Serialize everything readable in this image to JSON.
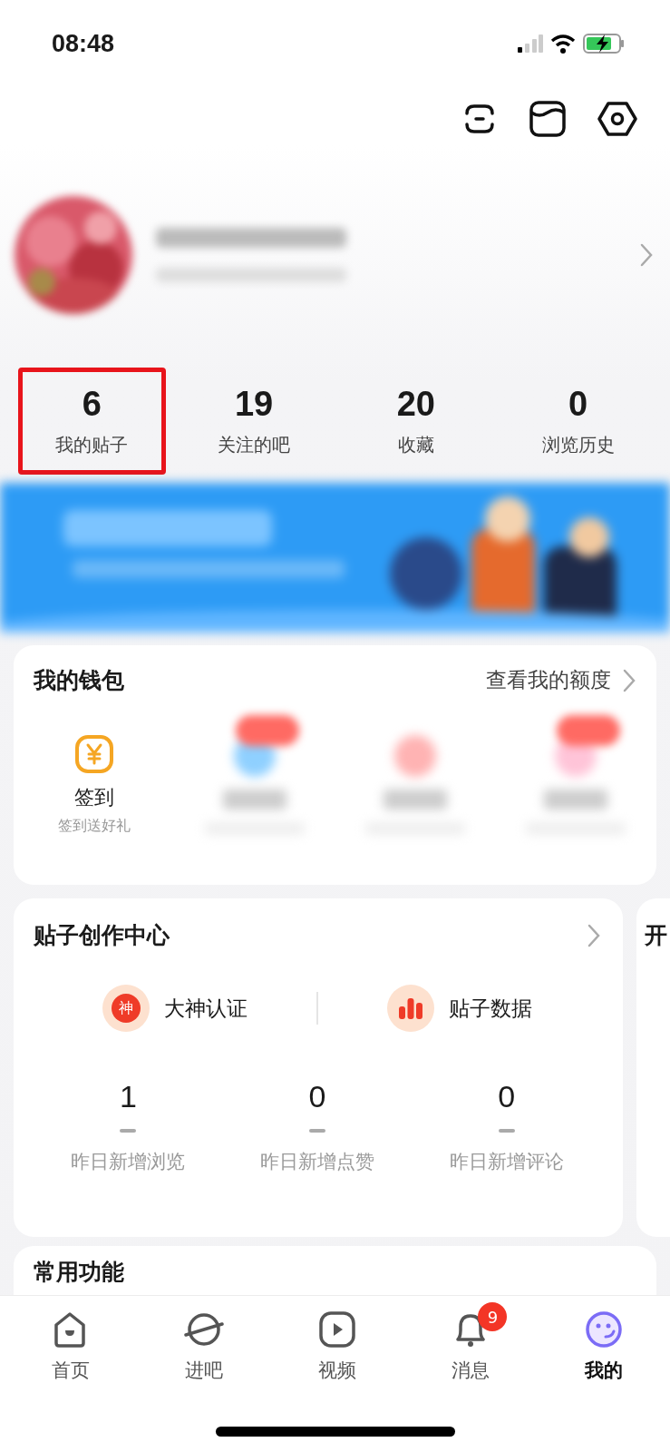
{
  "status_bar": {
    "time": "08:48"
  },
  "stats": [
    {
      "value": "6",
      "label": "我的贴子",
      "highlighted": true
    },
    {
      "value": "19",
      "label": "关注的吧",
      "highlighted": false
    },
    {
      "value": "20",
      "label": "收藏",
      "highlighted": false
    },
    {
      "value": "0",
      "label": "浏览历史",
      "highlighted": false
    }
  ],
  "wallet": {
    "title": "我的钱包",
    "link": "查看我的额度",
    "items": [
      {
        "kind": "visible",
        "title": "签到",
        "subtitle": "签到送好礼",
        "badge": false
      },
      {
        "kind": "blurred",
        "badge": true,
        "color": "#8fd0ff"
      },
      {
        "kind": "blurred",
        "badge": false,
        "color": "#ffb3b3"
      },
      {
        "kind": "blurred",
        "badge": true,
        "color": "#ffc4d8"
      }
    ]
  },
  "creation_center": {
    "title": "贴子创作中心",
    "shortcuts": [
      {
        "kind": "certify",
        "label": "大神认证",
        "icon_text": "神"
      },
      {
        "kind": "data",
        "label": "贴子数据"
      }
    ],
    "metrics": [
      {
        "value": "1",
        "label": "昨日新增浏览"
      },
      {
        "value": "0",
        "label": "昨日新增点赞"
      },
      {
        "value": "0",
        "label": "昨日新增评论"
      }
    ]
  },
  "next_card": {
    "title": "开"
  },
  "common": {
    "title": "常用功能"
  },
  "tab_bar": [
    {
      "kind": "home",
      "label": "首页",
      "selected": false
    },
    {
      "kind": "planet",
      "label": "进吧",
      "selected": false
    },
    {
      "kind": "video",
      "label": "视频",
      "selected": false
    },
    {
      "kind": "bell",
      "label": "消息",
      "selected": false,
      "badge": "9"
    },
    {
      "kind": "face",
      "label": "我的",
      "selected": true
    }
  ]
}
